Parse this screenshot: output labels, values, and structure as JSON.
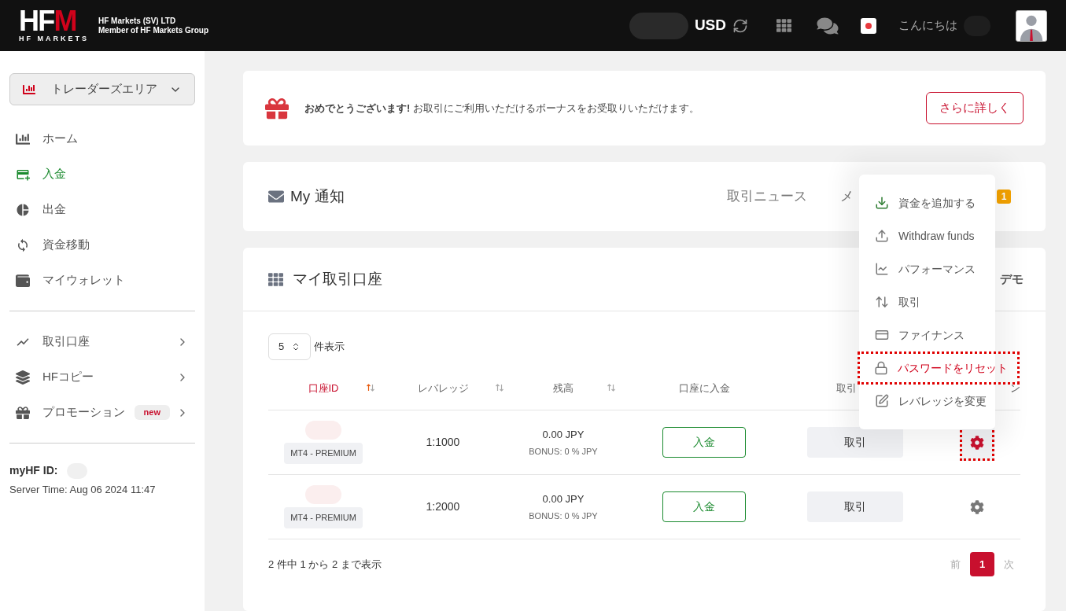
{
  "header": {
    "logo": {
      "main": "HF",
      "accent": "M",
      "sub": "HF MARKETS"
    },
    "company_lines": [
      "HF Markets (SV) LTD",
      "Member of HF Markets Group"
    ],
    "currency": "USD",
    "greeting": "こんにちは"
  },
  "sidebar": {
    "area_select": "トレーダーズエリア",
    "groups": [
      [
        {
          "label": "ホーム",
          "selected": false
        },
        {
          "label": "入金",
          "selected": true
        },
        {
          "label": "出金",
          "selected": false
        },
        {
          "label": "資金移動",
          "selected": false
        },
        {
          "label": "マイウォレット",
          "selected": false
        }
      ],
      [
        {
          "label": "取引口座",
          "selected": false,
          "submenu": true
        },
        {
          "label": "HFコピー",
          "selected": false,
          "submenu": true
        },
        {
          "label": "プロモーション",
          "selected": false,
          "submenu": true,
          "badge": "new"
        }
      ]
    ],
    "id_label": "myHF ID:",
    "server_time": "Server Time: Aug 06 2024 11:47"
  },
  "banner": {
    "text": "**おめでとうございます!** お取引にご利用いただけるボーナスをお受取りいただけます。",
    "button": "さらに詳しく"
  },
  "notifications": {
    "title": "My 通知",
    "tabs": [
      "取引ニュース",
      "メ"
    ],
    "badge": "1"
  },
  "accounts": {
    "title": "マイ取引口座",
    "tab_fragment": "デモ",
    "page_size": "5",
    "page_size_label": "件表示",
    "columns": [
      {
        "label": "口座ID",
        "sortable": true,
        "sorted": true
      },
      {
        "label": "レバレッジ",
        "sortable": true,
        "sorted": false
      },
      {
        "label": "残高",
        "sortable": true,
        "sorted": false
      },
      {
        "label": "口座に入金",
        "sortable": false,
        "sorted": false
      },
      {
        "label": "取引",
        "sorted": false
      },
      {
        "label": "ン",
        "sorted": false
      }
    ],
    "rows": [
      {
        "type": "MT4 - PREMIUM",
        "leverage": "1:1000",
        "balance": "0.00 JPY",
        "bonus": "BONUS: 0 % JPY",
        "deposit": "入金",
        "trade": "取引",
        "highlighted": true
      },
      {
        "type": "MT4 - PREMIUM",
        "leverage": "1:2000",
        "balance": "0.00 JPY",
        "bonus": "BONUS: 0 % JPY",
        "deposit": "入金",
        "trade": "取引",
        "highlighted": false
      }
    ],
    "summary": "2 件中 1 から 2 まで表示",
    "prev": "前",
    "pages": [
      {
        "label": "1",
        "selected": true
      }
    ],
    "next": "次"
  },
  "menu": {
    "items": [
      {
        "label": "資金を追加する",
        "highlighted": false
      },
      {
        "label": "Withdraw funds",
        "highlighted": false
      },
      {
        "label": "パフォーマンス",
        "highlighted": false
      },
      {
        "label": "取引",
        "highlighted": false
      },
      {
        "label": "ファイナンス",
        "highlighted": false
      },
      {
        "label": "パスワードをリセット",
        "highlighted": true
      },
      {
        "label": "レバレッジを変更",
        "highlighted": false
      }
    ]
  }
}
